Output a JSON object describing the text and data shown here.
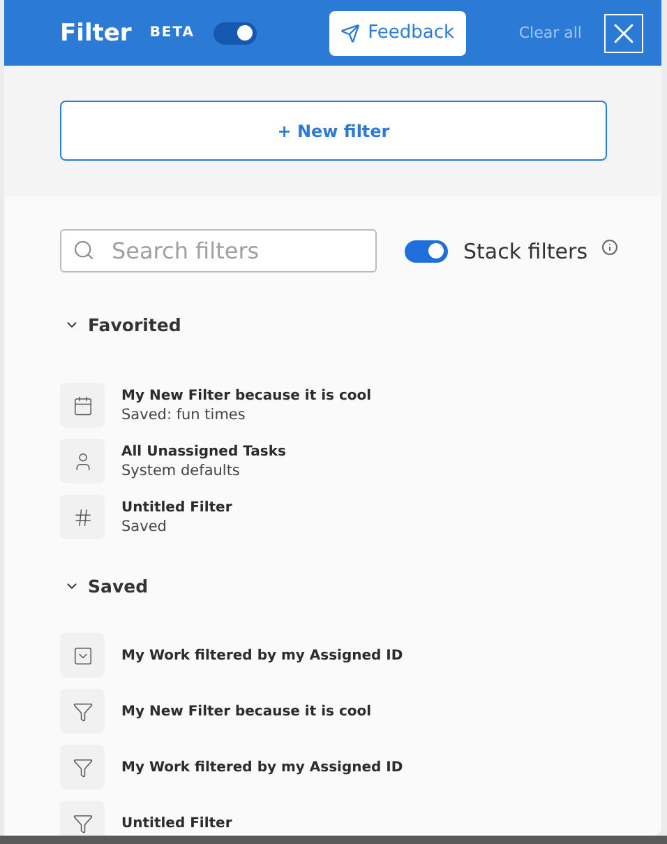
{
  "header": {
    "title": "Filter",
    "badge": "BETA",
    "beta_toggle": {
      "on": true
    },
    "feedback": "Feedback",
    "clear_all": "Clear all"
  },
  "new_filter": "+ New filter",
  "search": {
    "placeholder": "Search filters"
  },
  "stack": {
    "label": "Stack filters",
    "on": true
  },
  "sections": [
    {
      "title": "Favorited",
      "expanded": true,
      "items": [
        {
          "kind": "calendar",
          "name": "My New Filter because it is cool",
          "subtitle": "Saved: fun times"
        },
        {
          "kind": "person",
          "name": "All Unassigned Tasks",
          "subtitle": "System defaults"
        },
        {
          "kind": "hash",
          "name": "Untitled Filter",
          "subtitle": "Saved"
        }
      ]
    },
    {
      "title": "Saved",
      "expanded": true,
      "items": [
        {
          "kind": "inbox",
          "name": "My Work filtered by my Assigned ID"
        },
        {
          "kind": "funnel",
          "name": "My New Filter because it is cool"
        },
        {
          "kind": "funnel",
          "name": "My Work filtered by my Assigned ID"
        },
        {
          "kind": "funnel",
          "name": "Untitled Filter"
        }
      ]
    }
  ]
}
